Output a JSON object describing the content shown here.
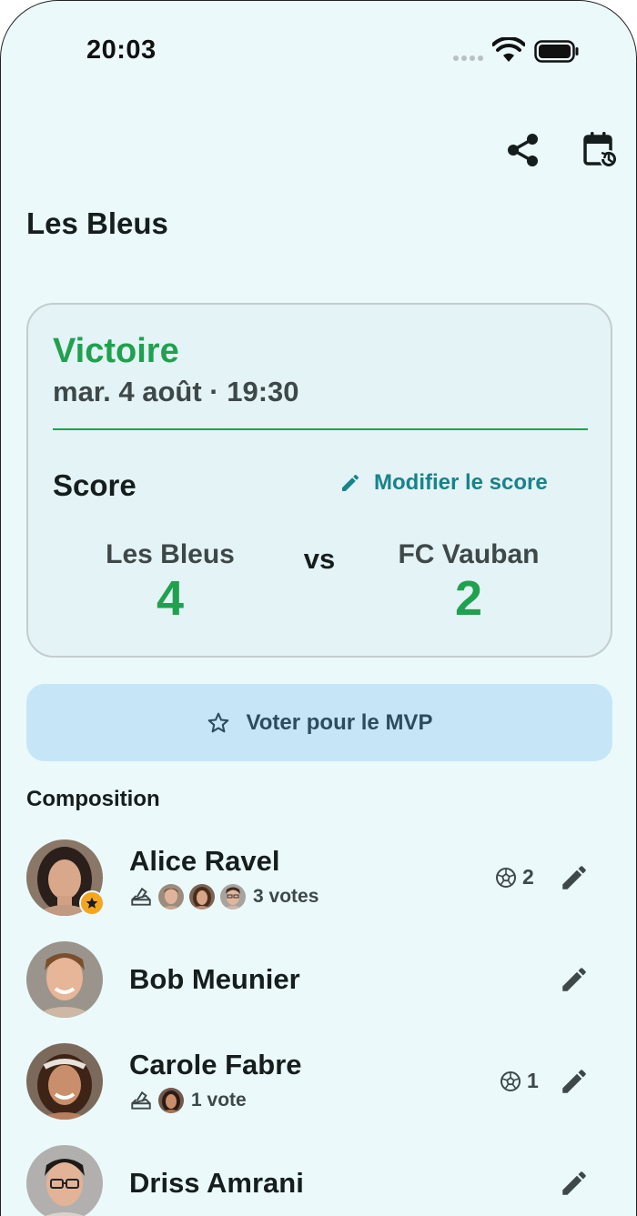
{
  "status_bar": {
    "time": "20:03"
  },
  "header": {
    "title": "Les Bleus",
    "actions": [
      {
        "icon": "share-icon"
      },
      {
        "icon": "calendar-refresh-icon"
      }
    ]
  },
  "match": {
    "result": "Victoire",
    "datetime": "mar. 4 août · 19:30",
    "score_label": "Score",
    "edit_score_label": "Modifier le score",
    "vs_label": "vs",
    "home": {
      "name": "Les Bleus",
      "goals": "4"
    },
    "away": {
      "name": "FC Vauban",
      "goals": "2"
    }
  },
  "mvp": {
    "label": "Voter pour le MVP",
    "icon": "star-outline-icon"
  },
  "roster": {
    "title": "Composition",
    "players": [
      {
        "name": "Alice Ravel",
        "is_mvp": true,
        "votes_text": "3 votes",
        "goals": "2"
      },
      {
        "name": "Bob Meunier",
        "is_mvp": false,
        "votes_text": "",
        "goals": ""
      },
      {
        "name": "Carole Fabre",
        "is_mvp": false,
        "votes_text": "1 vote",
        "goals": "1"
      },
      {
        "name": "Driss Amrani",
        "is_mvp": false,
        "votes_text": "",
        "goals": ""
      }
    ]
  },
  "colors": {
    "background": "#ebf9fb",
    "win": "#1fa14f",
    "accent": "#17838c",
    "mvp_button": "#c6e6f8",
    "mvp_badge": "#f5a51e"
  }
}
